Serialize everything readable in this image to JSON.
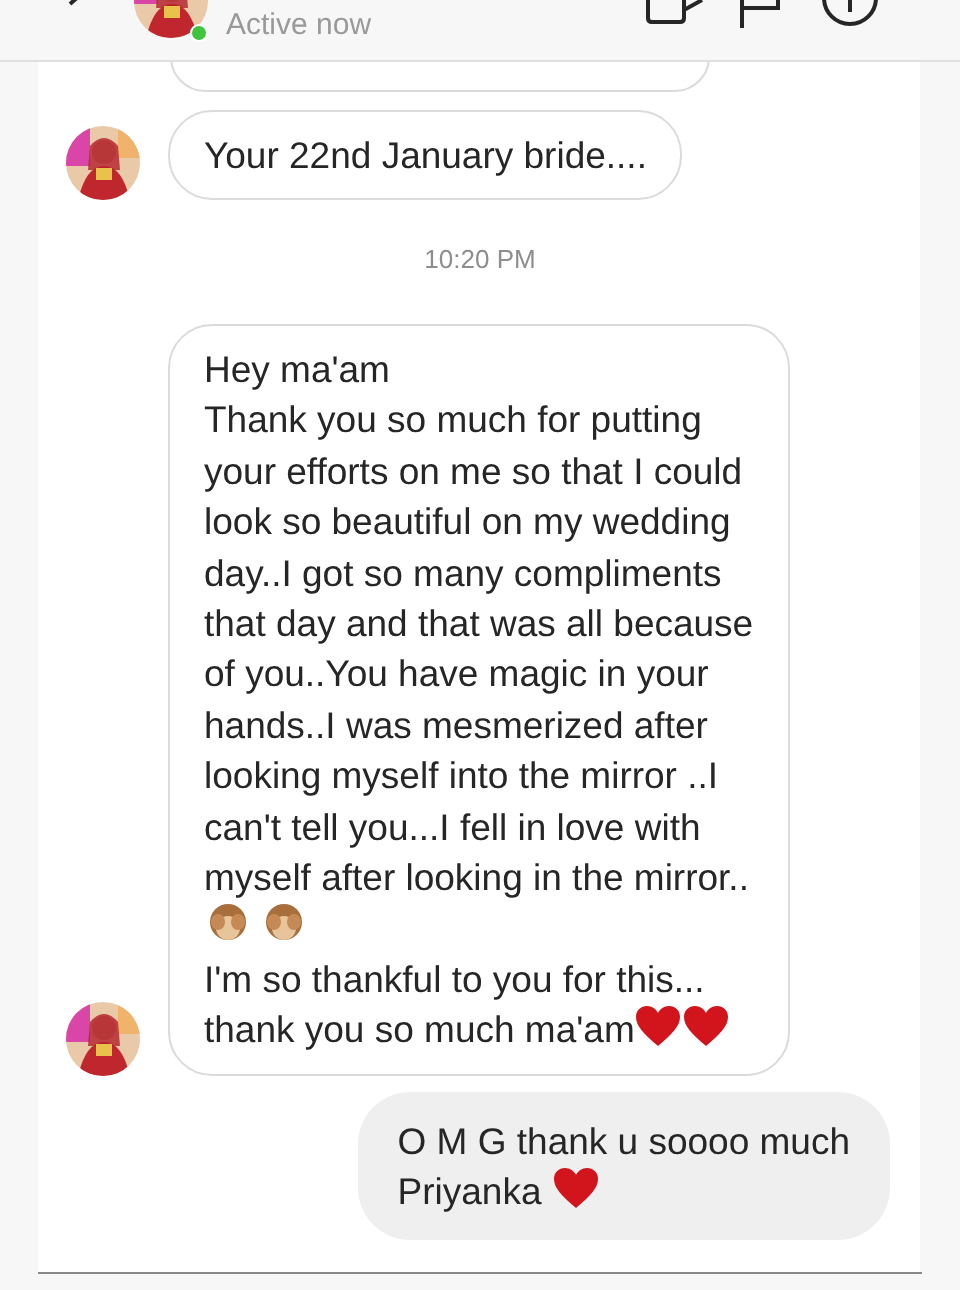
{
  "header": {
    "status": "Active now",
    "online": true
  },
  "messages": [
    {
      "kind": "cut"
    },
    {
      "kind": "incoming",
      "avatar": true,
      "lines": [
        [
          {
            "kind": "text",
            "text": "Your 22nd January bride...."
          }
        ]
      ]
    },
    {
      "kind": "time",
      "text": "10:20 PM"
    },
    {
      "kind": "incoming",
      "avatar": true,
      "lines": [
        [
          {
            "kind": "text",
            "text": "Hey ma'am"
          }
        ],
        [
          {
            "kind": "text",
            "text": "Thank you so much for putting"
          }
        ],
        [
          {
            "kind": "text",
            "text": "your efforts on me so that I could"
          }
        ],
        [
          {
            "kind": "text",
            "text": "look so beautiful on my wedding"
          }
        ],
        [
          {
            "kind": "text",
            "text": "day..I got so many compliments"
          }
        ],
        [
          {
            "kind": "text",
            "text": "that day and that was all because"
          }
        ],
        [
          {
            "kind": "text",
            "text": "of you..You have magic in your"
          }
        ],
        [
          {
            "kind": "text",
            "text": "hands..I was mesmerized after"
          }
        ],
        [
          {
            "kind": "text",
            "text": "looking myself into the mirror ..I"
          }
        ],
        [
          {
            "kind": "text",
            "text": "can't tell you...I fell in love with"
          }
        ],
        [
          {
            "kind": "text",
            "text": "myself after looking in the mirror.."
          }
        ],
        [
          {
            "kind": "monkey"
          },
          {
            "kind": "monkey"
          }
        ],
        [
          {
            "kind": "text",
            "text": "I'm so thankful to you for this..."
          }
        ],
        [
          {
            "kind": "text",
            "text": "thank you so much ma'am"
          },
          {
            "kind": "heart"
          },
          {
            "kind": "heart"
          }
        ]
      ]
    },
    {
      "kind": "outgoing",
      "lines": [
        [
          {
            "kind": "text",
            "text": "O M G thank u soooo much"
          }
        ],
        [
          {
            "kind": "text",
            "text": "Priyanka "
          },
          {
            "kind": "heart"
          }
        ]
      ]
    }
  ]
}
